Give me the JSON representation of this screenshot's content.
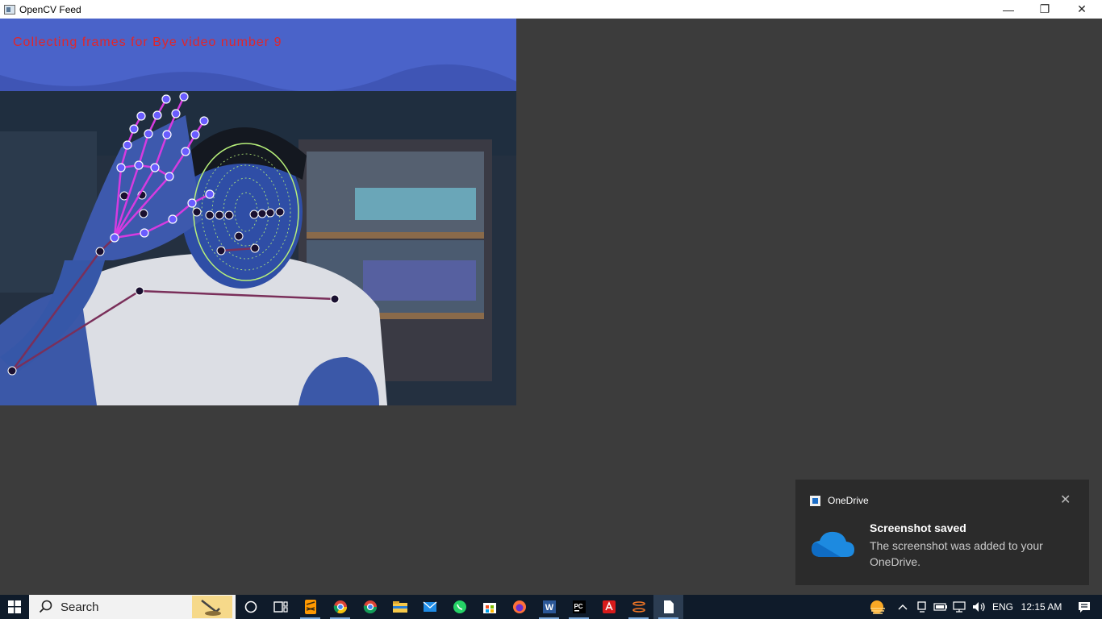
{
  "window": {
    "title": "OpenCV Feed",
    "minimize": "—",
    "maximize": "❐",
    "close": "✕"
  },
  "feed": {
    "overlay_text": "Collecting frames for Bye video number 9"
  },
  "toast": {
    "app": "OneDrive",
    "close": "✕",
    "title": "Screenshot saved",
    "body": "The screenshot was added to your OneDrive."
  },
  "taskbar": {
    "search_placeholder": "Search",
    "apps": [
      "cortana-icon",
      "task-view-icon",
      "sublime-icon",
      "chrome-icon",
      "chrome-alt-icon",
      "file-explorer-icon",
      "mail-icon",
      "whatsapp-icon",
      "store-icon",
      "firefox-icon",
      "word-icon",
      "pycharm-icon",
      "acrobat-icon",
      "jupyter-icon",
      "notepad-icon"
    ],
    "tray": {
      "language": "ENG",
      "time": "12:15 AM"
    }
  },
  "colors": {
    "accent": "#0078d7",
    "overlay_text": "#e0262b",
    "toast_bg": "#2b2b2b",
    "taskbar_bg": "#0f1b2a"
  }
}
